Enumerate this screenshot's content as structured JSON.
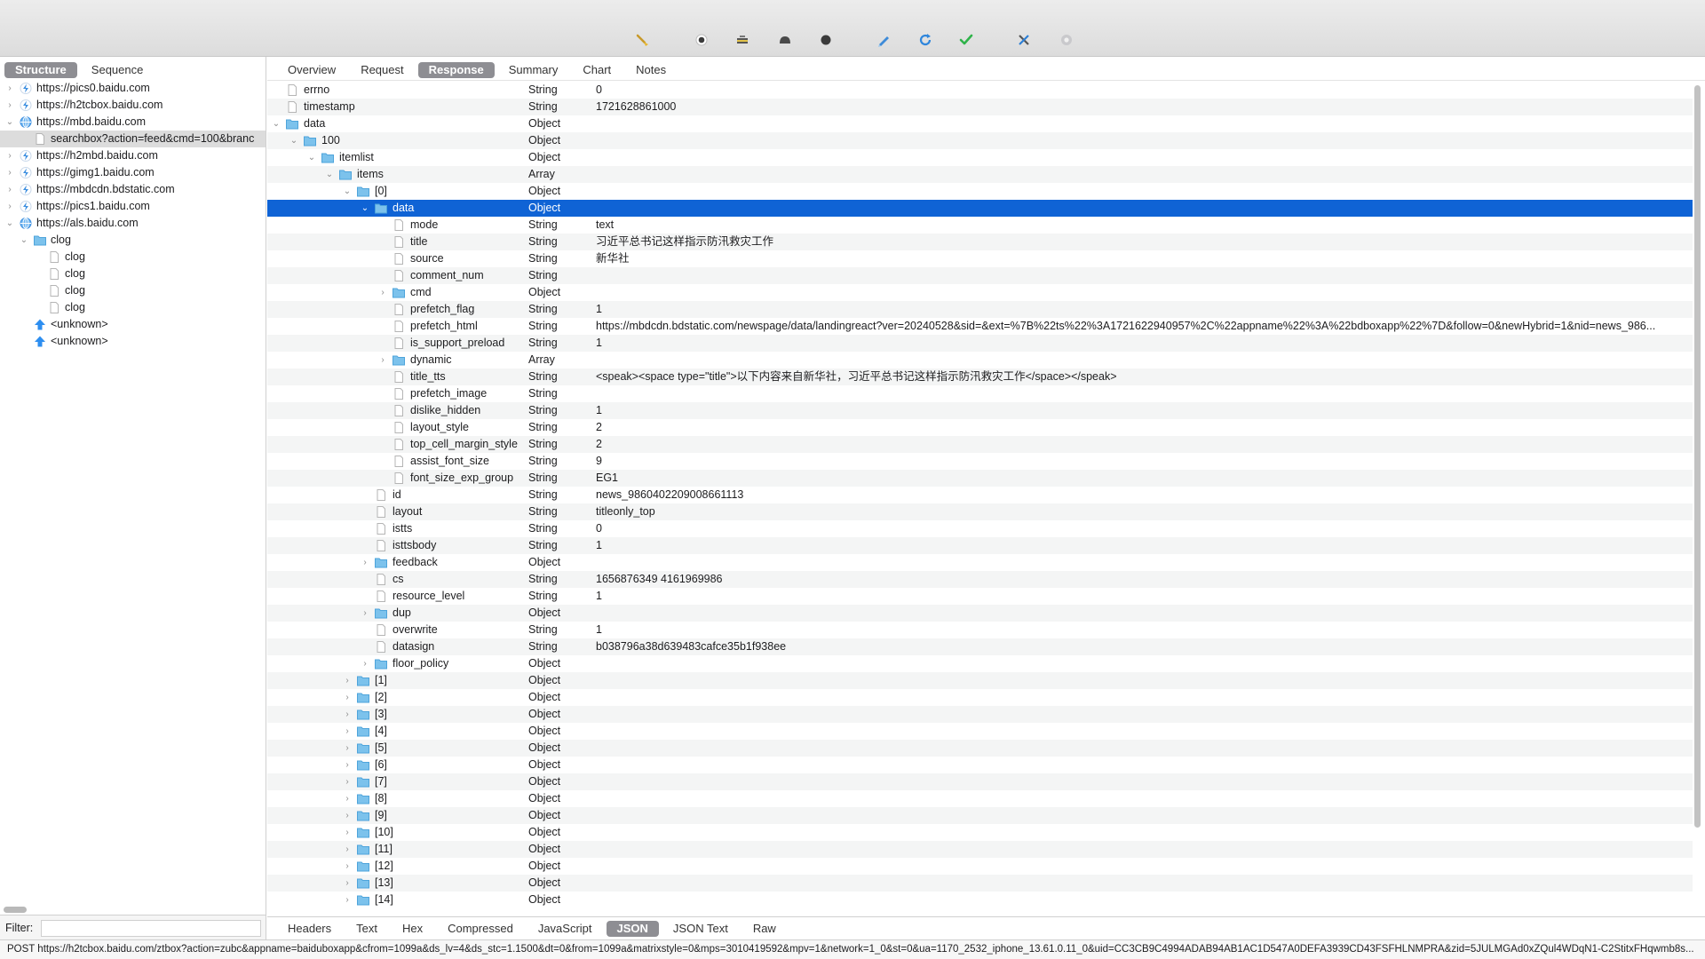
{
  "toolbar": {
    "icons": [
      "broom-icon",
      "record-icon",
      "throttle-icon",
      "breakpoint-icon",
      "stop-icon",
      "compose-icon",
      "refresh-icon",
      "validate-icon",
      "tools-icon",
      "settings-icon"
    ]
  },
  "left": {
    "tabs": [
      "Structure",
      "Sequence"
    ],
    "active_tab": "Structure",
    "filter_label": "Filter:",
    "filter_value": "",
    "tree": [
      {
        "label": "https://pics0.baidu.com",
        "depth": 0,
        "kind": "host-lightning",
        "expanded": false,
        "chevron": true
      },
      {
        "label": "https://h2tcbox.baidu.com",
        "depth": 0,
        "kind": "host-lightning",
        "expanded": false,
        "chevron": true
      },
      {
        "label": "https://mbd.baidu.com",
        "depth": 0,
        "kind": "host-globe",
        "expanded": true,
        "chevron": true
      },
      {
        "label": "searchbox?action=feed&cmd=100&branc",
        "depth": 1,
        "kind": "doc",
        "expanded": false,
        "chevron": false,
        "selected": true
      },
      {
        "label": "https://h2mbd.baidu.com",
        "depth": 0,
        "kind": "host-lightning",
        "expanded": false,
        "chevron": true
      },
      {
        "label": "https://gimg1.baidu.com",
        "depth": 0,
        "kind": "host-lightning",
        "expanded": false,
        "chevron": true
      },
      {
        "label": "https://mbdcdn.bdstatic.com",
        "depth": 0,
        "kind": "host-lightning",
        "expanded": false,
        "chevron": true
      },
      {
        "label": "https://pics1.baidu.com",
        "depth": 0,
        "kind": "host-lightning",
        "expanded": false,
        "chevron": true
      },
      {
        "label": "https://als.baidu.com",
        "depth": 0,
        "kind": "host-globe",
        "expanded": true,
        "chevron": true
      },
      {
        "label": "clog",
        "depth": 1,
        "kind": "folder",
        "expanded": true,
        "chevron": true
      },
      {
        "label": "clog",
        "depth": 2,
        "kind": "doc",
        "expanded": false,
        "chevron": false
      },
      {
        "label": "clog",
        "depth": 2,
        "kind": "doc",
        "expanded": false,
        "chevron": false
      },
      {
        "label": "clog",
        "depth": 2,
        "kind": "doc",
        "expanded": false,
        "chevron": false
      },
      {
        "label": "clog",
        "depth": 2,
        "kind": "doc",
        "expanded": false,
        "chevron": false
      },
      {
        "label": "<unknown>",
        "depth": 1,
        "kind": "upload",
        "expanded": false,
        "chevron": false
      },
      {
        "label": "<unknown>",
        "depth": 1,
        "kind": "upload",
        "expanded": false,
        "chevron": false
      }
    ]
  },
  "right": {
    "tabs": [
      "Overview",
      "Request",
      "Response",
      "Summary",
      "Chart",
      "Notes"
    ],
    "active_tab": "Response",
    "bottom_tabs": [
      "Headers",
      "Text",
      "Hex",
      "Compressed",
      "JavaScript",
      "JSON",
      "JSON Text",
      "Raw"
    ],
    "active_bottom_tab": "JSON",
    "rows": [
      {
        "name": "errno",
        "type": "String",
        "value": "0",
        "depth": 0,
        "kind": "doc",
        "chevron": ""
      },
      {
        "name": "timestamp",
        "type": "String",
        "value": "1721628861000",
        "depth": 0,
        "kind": "doc",
        "chevron": ""
      },
      {
        "name": "data",
        "type": "Object",
        "value": "",
        "depth": 0,
        "kind": "folder",
        "chevron": "open"
      },
      {
        "name": "100",
        "type": "Object",
        "value": "",
        "depth": 1,
        "kind": "folder",
        "chevron": "open"
      },
      {
        "name": "itemlist",
        "type": "Object",
        "value": "",
        "depth": 2,
        "kind": "folder",
        "chevron": "open"
      },
      {
        "name": "items",
        "type": "Array",
        "value": "",
        "depth": 3,
        "kind": "folder",
        "chevron": "open"
      },
      {
        "name": "[0]",
        "type": "Object",
        "value": "",
        "depth": 4,
        "kind": "folder",
        "chevron": "open"
      },
      {
        "name": "data",
        "type": "Object",
        "value": "",
        "depth": 5,
        "kind": "folder",
        "chevron": "open",
        "selected": true
      },
      {
        "name": "mode",
        "type": "String",
        "value": "text",
        "depth": 6,
        "kind": "doc",
        "chevron": ""
      },
      {
        "name": "title",
        "type": "String",
        "value": "习近平总书记这样指示防汛救灾工作",
        "depth": 6,
        "kind": "doc",
        "chevron": ""
      },
      {
        "name": "source",
        "type": "String",
        "value": "新华社",
        "depth": 6,
        "kind": "doc",
        "chevron": ""
      },
      {
        "name": "comment_num",
        "type": "String",
        "value": "",
        "depth": 6,
        "kind": "doc",
        "chevron": ""
      },
      {
        "name": "cmd",
        "type": "Object",
        "value": "",
        "depth": 6,
        "kind": "folder",
        "chevron": "closed"
      },
      {
        "name": "prefetch_flag",
        "type": "String",
        "value": "1",
        "depth": 6,
        "kind": "doc",
        "chevron": ""
      },
      {
        "name": "prefetch_html",
        "type": "String",
        "value": "https://mbdcdn.bdstatic.com/newspage/data/landingreact?ver=20240528&sid=&ext=%7B%22ts%22%3A1721622940957%2C%22appname%22%3A%22bdboxapp%22%7D&follow=0&newHybrid=1&nid=news_986...",
        "depth": 6,
        "kind": "doc",
        "chevron": ""
      },
      {
        "name": "is_support_preload",
        "type": "String",
        "value": "1",
        "depth": 6,
        "kind": "doc",
        "chevron": ""
      },
      {
        "name": "dynamic",
        "type": "Array",
        "value": "",
        "depth": 6,
        "kind": "folder",
        "chevron": "closed"
      },
      {
        "name": "title_tts",
        "type": "String",
        "value": "<speak><space type=\"title\">以下内容来自新华社，习近平总书记这样指示防汛救灾工作</space></speak>",
        "depth": 6,
        "kind": "doc",
        "chevron": ""
      },
      {
        "name": "prefetch_image",
        "type": "String",
        "value": "",
        "depth": 6,
        "kind": "doc",
        "chevron": ""
      },
      {
        "name": "dislike_hidden",
        "type": "String",
        "value": "1",
        "depth": 6,
        "kind": "doc",
        "chevron": ""
      },
      {
        "name": "layout_style",
        "type": "String",
        "value": "2",
        "depth": 6,
        "kind": "doc",
        "chevron": ""
      },
      {
        "name": "top_cell_margin_style",
        "type": "String",
        "value": "2",
        "depth": 6,
        "kind": "doc",
        "chevron": ""
      },
      {
        "name": "assist_font_size",
        "type": "String",
        "value": "9",
        "depth": 6,
        "kind": "doc",
        "chevron": ""
      },
      {
        "name": "font_size_exp_group",
        "type": "String",
        "value": "EG1",
        "depth": 6,
        "kind": "doc",
        "chevron": ""
      },
      {
        "name": "id",
        "type": "String",
        "value": "news_9860402209008661113",
        "depth": 5,
        "kind": "doc",
        "chevron": ""
      },
      {
        "name": "layout",
        "type": "String",
        "value": "titleonly_top",
        "depth": 5,
        "kind": "doc",
        "chevron": ""
      },
      {
        "name": "istts",
        "type": "String",
        "value": "0",
        "depth": 5,
        "kind": "doc",
        "chevron": ""
      },
      {
        "name": "isttsbody",
        "type": "String",
        "value": "1",
        "depth": 5,
        "kind": "doc",
        "chevron": ""
      },
      {
        "name": "feedback",
        "type": "Object",
        "value": "",
        "depth": 5,
        "kind": "folder",
        "chevron": "closed"
      },
      {
        "name": "cs",
        "type": "String",
        "value": "1656876349 4161969986",
        "depth": 5,
        "kind": "doc",
        "chevron": ""
      },
      {
        "name": "resource_level",
        "type": "String",
        "value": "1",
        "depth": 5,
        "kind": "doc",
        "chevron": ""
      },
      {
        "name": "dup",
        "type": "Object",
        "value": "",
        "depth": 5,
        "kind": "folder",
        "chevron": "closed"
      },
      {
        "name": "overwrite",
        "type": "String",
        "value": "1",
        "depth": 5,
        "kind": "doc",
        "chevron": ""
      },
      {
        "name": "datasign",
        "type": "String",
        "value": "b038796a38d639483cafce35b1f938ee",
        "depth": 5,
        "kind": "doc",
        "chevron": ""
      },
      {
        "name": "floor_policy",
        "type": "Object",
        "value": "",
        "depth": 5,
        "kind": "folder",
        "chevron": "closed"
      },
      {
        "name": "[1]",
        "type": "Object",
        "value": "",
        "depth": 4,
        "kind": "folder",
        "chevron": "closed"
      },
      {
        "name": "[2]",
        "type": "Object",
        "value": "",
        "depth": 4,
        "kind": "folder",
        "chevron": "closed"
      },
      {
        "name": "[3]",
        "type": "Object",
        "value": "",
        "depth": 4,
        "kind": "folder",
        "chevron": "closed"
      },
      {
        "name": "[4]",
        "type": "Object",
        "value": "",
        "depth": 4,
        "kind": "folder",
        "chevron": "closed"
      },
      {
        "name": "[5]",
        "type": "Object",
        "value": "",
        "depth": 4,
        "kind": "folder",
        "chevron": "closed"
      },
      {
        "name": "[6]",
        "type": "Object",
        "value": "",
        "depth": 4,
        "kind": "folder",
        "chevron": "closed"
      },
      {
        "name": "[7]",
        "type": "Object",
        "value": "",
        "depth": 4,
        "kind": "folder",
        "chevron": "closed"
      },
      {
        "name": "[8]",
        "type": "Object",
        "value": "",
        "depth": 4,
        "kind": "folder",
        "chevron": "closed"
      },
      {
        "name": "[9]",
        "type": "Object",
        "value": "",
        "depth": 4,
        "kind": "folder",
        "chevron": "closed"
      },
      {
        "name": "[10]",
        "type": "Object",
        "value": "",
        "depth": 4,
        "kind": "folder",
        "chevron": "closed"
      },
      {
        "name": "[11]",
        "type": "Object",
        "value": "",
        "depth": 4,
        "kind": "folder",
        "chevron": "closed"
      },
      {
        "name": "[12]",
        "type": "Object",
        "value": "",
        "depth": 4,
        "kind": "folder",
        "chevron": "closed"
      },
      {
        "name": "[13]",
        "type": "Object",
        "value": "",
        "depth": 4,
        "kind": "folder",
        "chevron": "closed"
      },
      {
        "name": "[14]",
        "type": "Object",
        "value": "",
        "depth": 4,
        "kind": "folder",
        "chevron": "closed"
      }
    ]
  },
  "status": {
    "text": "POST https://h2tcbox.baidu.com/ztbox?action=zubc&appname=baiduboxapp&cfrom=1099a&ds_lv=4&ds_stc=1.1500&dt=0&from=1099a&matrixstyle=0&mps=3010419592&mpv=1&network=1_0&st=0&ua=1170_2532_iphone_13.61.0.11_0&uid=CC3CB9C4994ADAB94AB1AC1D547A0DEFA3939CD43FSFHLNMPRA&zid=5JULMGAd0xZQul4WDqN1-C2StitxFHqwmb8s..."
  },
  "colors": {
    "selection": "#0f63d5",
    "folder": "#7cc2ec",
    "host_icon": "#3d8fe0",
    "upload_icon": "#2d8ef0",
    "active_tab": "#8e8e93"
  }
}
